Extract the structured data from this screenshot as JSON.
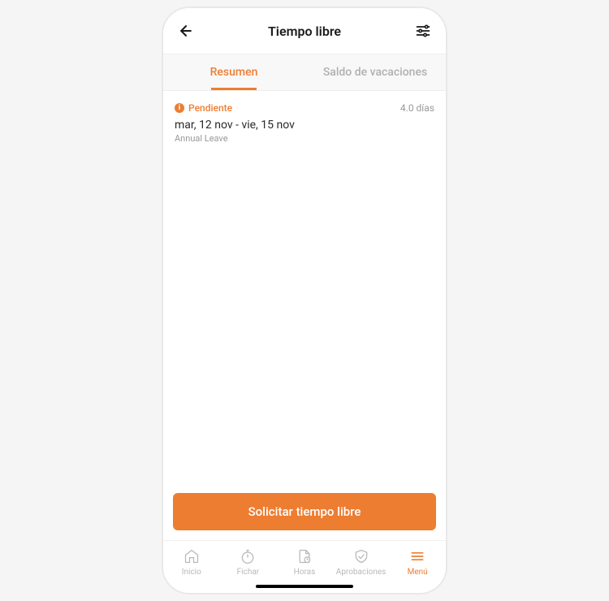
{
  "header": {
    "title": "Tiempo libre"
  },
  "tabs": [
    {
      "label": "Resumen",
      "active": true
    },
    {
      "label": "Saldo de vacaciones",
      "active": false
    }
  ],
  "request": {
    "status": "Pendiente",
    "duration": "4.0 días",
    "date_range": "mar, 12 nov - vie, 15 nov",
    "leave_type": "Annual Leave"
  },
  "cta": {
    "label": "Solicitar tiempo libre"
  },
  "nav": [
    {
      "label": "Inicio"
    },
    {
      "label": "Fichar"
    },
    {
      "label": "Horas"
    },
    {
      "label": "Aprobaciones"
    },
    {
      "label": "Menú"
    }
  ]
}
